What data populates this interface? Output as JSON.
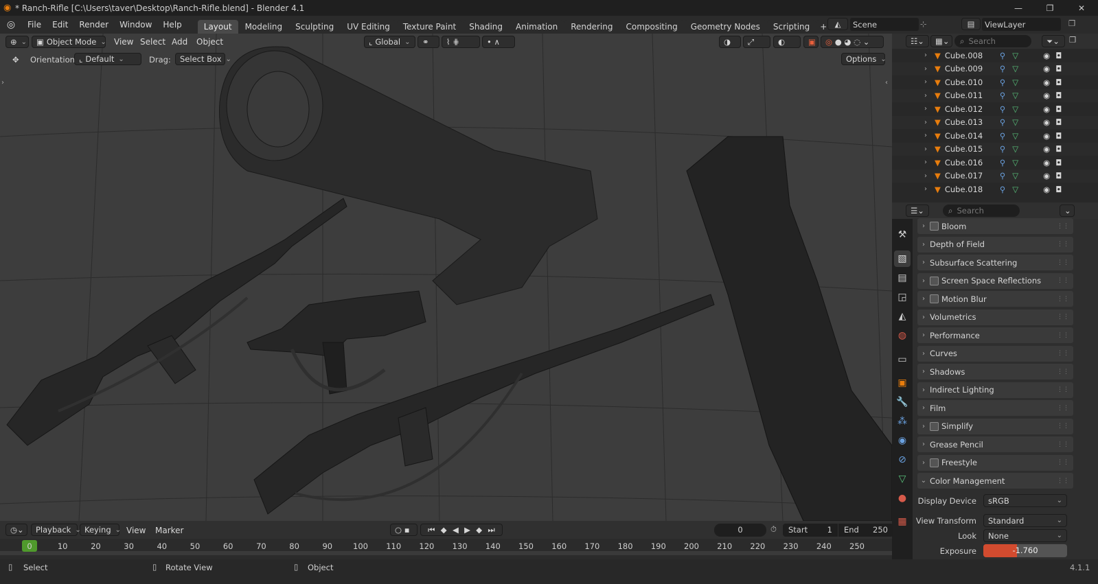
{
  "window": {
    "title": "* Ranch-Rifle [C:\\Users\\taver\\Desktop\\Ranch-Rifle.blend] - Blender 4.1",
    "minimize": "—",
    "maximize": "❐",
    "close": "✕"
  },
  "menu": [
    "File",
    "Edit",
    "Render",
    "Window",
    "Help"
  ],
  "workspaces": [
    "Layout",
    "Modeling",
    "Sculpting",
    "UV Editing",
    "Texture Paint",
    "Shading",
    "Animation",
    "Rendering",
    "Compositing",
    "Geometry Nodes",
    "Scripting"
  ],
  "active_workspace": "Layout",
  "add_workspace": "+",
  "scene": {
    "label": "Scene"
  },
  "view_layer": {
    "label": "ViewLayer"
  },
  "viewport_header": {
    "mode": "Object Mode",
    "menus": [
      "View",
      "Select",
      "Add",
      "Object"
    ],
    "transform_orientation": "Global",
    "options": "Options"
  },
  "tool_settings": {
    "orientation_label": "Orientation:",
    "orientation_value": "Default",
    "drag_label": "Drag:",
    "drag_value": "Select Box"
  },
  "outliner": {
    "search_placeholder": "Search",
    "items": [
      "Cube.008",
      "Cube.009",
      "Cube.010",
      "Cube.011",
      "Cube.012",
      "Cube.013",
      "Cube.014",
      "Cube.015",
      "Cube.016",
      "Cube.017",
      "Cube.018"
    ]
  },
  "properties": {
    "search_placeholder": "Search",
    "panels": [
      {
        "label": "Bloom",
        "checkbox": true,
        "open": false
      },
      {
        "label": "Depth of Field",
        "checkbox": false,
        "open": false
      },
      {
        "label": "Subsurface Scattering",
        "checkbox": false,
        "open": false
      },
      {
        "label": "Screen Space Reflections",
        "checkbox": true,
        "open": false
      },
      {
        "label": "Motion Blur",
        "checkbox": true,
        "open": false
      },
      {
        "label": "Volumetrics",
        "checkbox": false,
        "open": false
      },
      {
        "label": "Performance",
        "checkbox": false,
        "open": false
      },
      {
        "label": "Curves",
        "checkbox": false,
        "open": false
      },
      {
        "label": "Shadows",
        "checkbox": false,
        "open": false
      },
      {
        "label": "Indirect Lighting",
        "checkbox": false,
        "open": false
      },
      {
        "label": "Film",
        "checkbox": false,
        "open": false
      },
      {
        "label": "Simplify",
        "checkbox": true,
        "open": false
      },
      {
        "label": "Grease Pencil",
        "checkbox": false,
        "open": false
      },
      {
        "label": "Freestyle",
        "checkbox": true,
        "open": false
      },
      {
        "label": "Color Management",
        "checkbox": false,
        "open": true
      }
    ],
    "color_management": {
      "display_device_label": "Display Device",
      "display_device": "sRGB",
      "view_transform_label": "View Transform",
      "view_transform": "Standard",
      "look_label": "Look",
      "look": "None",
      "exposure_label": "Exposure",
      "exposure": "-1.760"
    }
  },
  "timeline": {
    "menus": [
      "Playback",
      "Keying",
      "View",
      "Marker"
    ],
    "current_frame": "0",
    "start_label": "Start",
    "start": "1",
    "end_label": "End",
    "end": "250",
    "ticks": [
      "0",
      "10",
      "20",
      "30",
      "40",
      "50",
      "60",
      "70",
      "80",
      "90",
      "100",
      "110",
      "120",
      "130",
      "140",
      "150",
      "160",
      "170",
      "180",
      "190",
      "200",
      "210",
      "220",
      "230",
      "240",
      "250"
    ]
  },
  "statusbar": {
    "select": "Select",
    "rotate": "Rotate View",
    "object": "Object",
    "version": "4.1.1"
  },
  "colors": {
    "accent_orange": "#e87d0d",
    "active_tab": "#4a4a4a",
    "exposure_fill": "#d24b2f",
    "frame_green": "#4f9a2c"
  },
  "icons": [
    "blender-logo-icon",
    "object-mode-icon",
    "transform-orientation-icon",
    "snap-icon",
    "proportional-editing-icon",
    "viewport-shading-icons",
    "outliner-editor-icon",
    "filter-icon",
    "mesh-icon",
    "modifier-icon",
    "vertex-group-icon",
    "eye-icon",
    "camera-icon",
    "properties-tab-icons",
    "play-icon",
    "clock-icon"
  ]
}
